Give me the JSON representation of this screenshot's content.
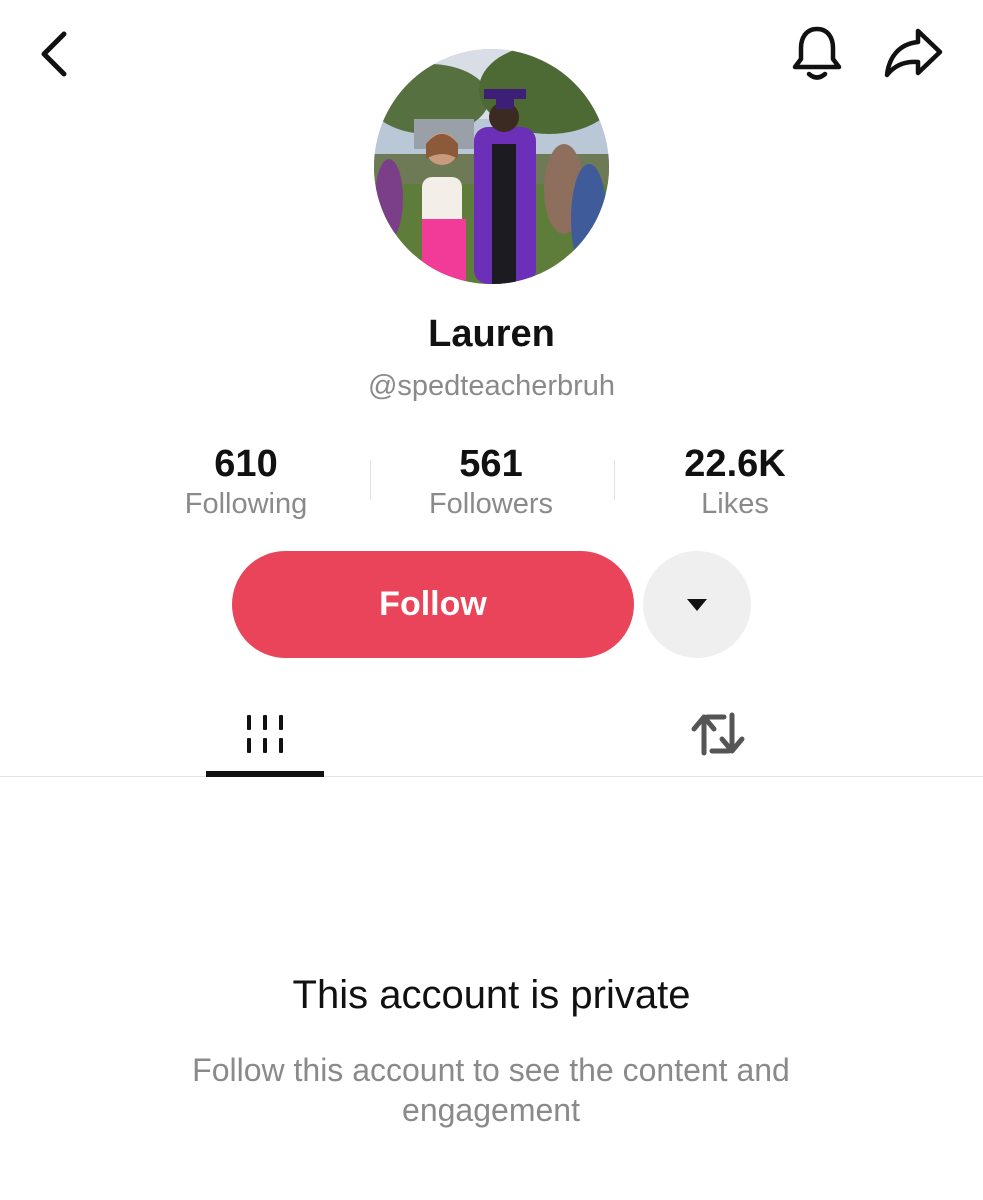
{
  "header": {
    "back_icon": "chevron-left-icon",
    "notification_icon": "bell-icon",
    "share_icon": "share-arrow-icon"
  },
  "profile": {
    "display_name": "Lauren",
    "username": "@spedteacherbruh",
    "avatar": "graduation-photo"
  },
  "stats": [
    {
      "value": "610",
      "label": "Following"
    },
    {
      "value": "561",
      "label": "Followers"
    },
    {
      "value": "22.6K",
      "label": "Likes"
    }
  ],
  "actions": {
    "follow_label": "Follow",
    "follow_color": "#e9445a",
    "more_icon": "caret-down-icon"
  },
  "tabs": [
    {
      "icon": "grid-icon",
      "active": true
    },
    {
      "icon": "repost-icon",
      "active": false
    }
  ],
  "private_notice": {
    "title": "This account is private",
    "description": "Follow this account to see the content and engagement"
  }
}
